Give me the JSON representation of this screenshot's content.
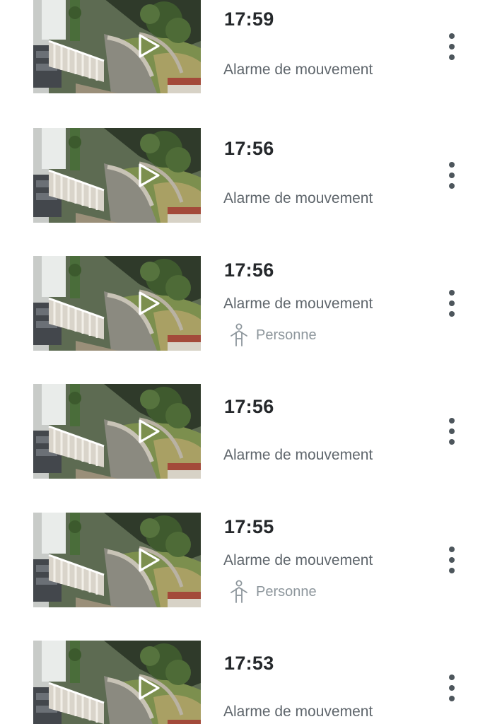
{
  "events": [
    {
      "time": "17:59",
      "type": "Alarme de mouvement",
      "tag": null,
      "play_icon": "play-icon",
      "menu_icon": "more-vertical-icon"
    },
    {
      "time": "17:56",
      "type": "Alarme de mouvement",
      "tag": null,
      "play_icon": "play-icon",
      "menu_icon": "more-vertical-icon"
    },
    {
      "time": "17:56",
      "type": "Alarme de mouvement",
      "tag": {
        "label": "Personne",
        "icon": "person-icon"
      },
      "play_icon": "play-icon",
      "menu_icon": "more-vertical-icon"
    },
    {
      "time": "17:56",
      "type": "Alarme de mouvement",
      "tag": null,
      "play_icon": "play-icon",
      "menu_icon": "more-vertical-icon"
    },
    {
      "time": "17:55",
      "type": "Alarme de mouvement",
      "tag": {
        "label": "Personne",
        "icon": "person-icon"
      },
      "play_icon": "play-icon",
      "menu_icon": "more-vertical-icon"
    },
    {
      "time": "17:53",
      "type": "Alarme de mouvement",
      "tag": null,
      "play_icon": "play-icon",
      "menu_icon": "more-vertical-icon"
    }
  ],
  "colors": {
    "time_text": "#25282b",
    "type_text": "#5f666c",
    "tag_text": "#8d969c",
    "menu_dots": "#4d565c",
    "background": "#ffffff"
  }
}
